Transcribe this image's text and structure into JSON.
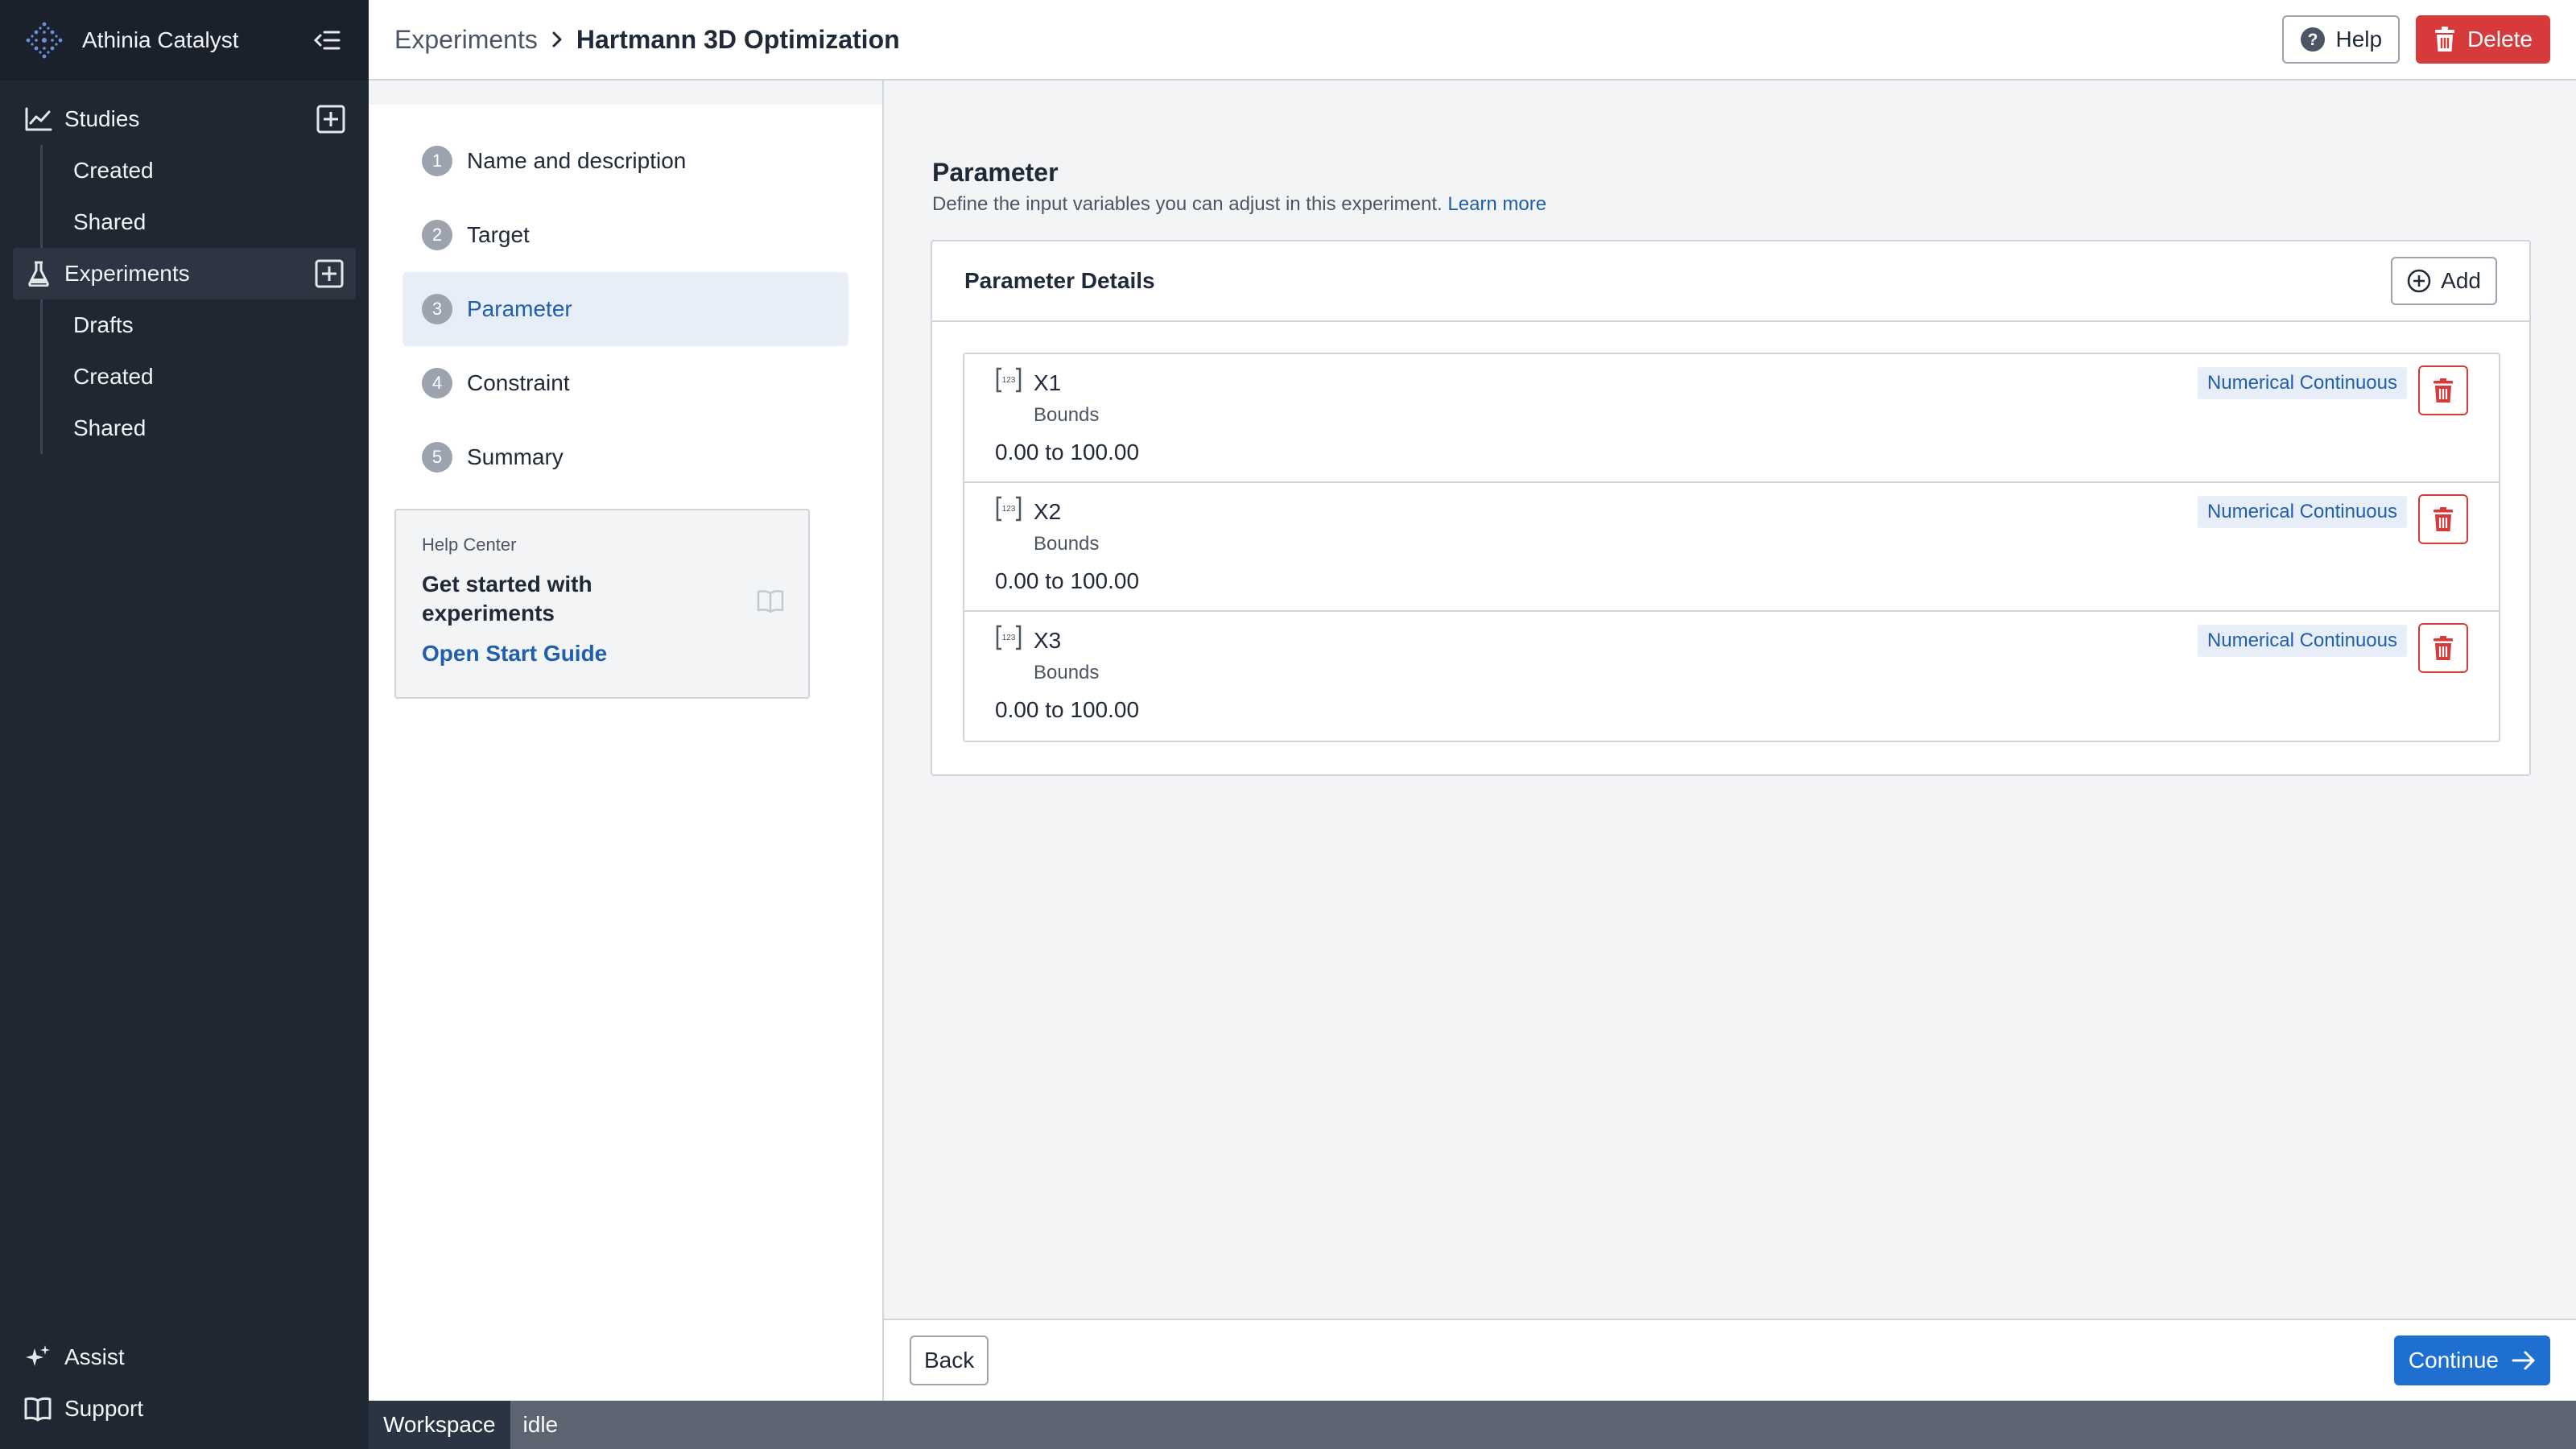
{
  "app": {
    "name": "Athinia Catalyst"
  },
  "sidebar": {
    "sections": [
      {
        "label": "Studies",
        "items": [
          "Created",
          "Shared"
        ]
      },
      {
        "label": "Experiments",
        "items": [
          "Drafts",
          "Created",
          "Shared"
        ]
      }
    ],
    "footer": [
      "Assist",
      "Support"
    ]
  },
  "header": {
    "breadcrumb_parent": "Experiments",
    "breadcrumb_current": "Hartmann 3D Optimization",
    "help_label": "Help",
    "delete_label": "Delete"
  },
  "steps": [
    {
      "num": "1",
      "label": "Name and description"
    },
    {
      "num": "2",
      "label": "Target"
    },
    {
      "num": "3",
      "label": "Parameter"
    },
    {
      "num": "4",
      "label": "Constraint"
    },
    {
      "num": "5",
      "label": "Summary"
    }
  ],
  "help_card": {
    "kicker": "Help Center",
    "title": "Get started with experiments",
    "link": "Open Start Guide"
  },
  "main": {
    "title": "Parameter",
    "description": "Define the input variables you can adjust in this experiment.",
    "learn_more": "Learn more",
    "card_title": "Parameter Details",
    "add_label": "Add",
    "parameters": [
      {
        "name": "X1",
        "sub": "Bounds",
        "range": "0.00 to 100.00",
        "type": "Numerical Continuous"
      },
      {
        "name": "X2",
        "sub": "Bounds",
        "range": "0.00 to 100.00",
        "type": "Numerical Continuous"
      },
      {
        "name": "X3",
        "sub": "Bounds",
        "range": "0.00 to 100.00",
        "type": "Numerical Continuous"
      }
    ]
  },
  "footer": {
    "back_label": "Back",
    "continue_label": "Continue"
  },
  "status": {
    "workspace": "Workspace",
    "state": "idle"
  },
  "colors": {
    "sidebar_bg": "#1f2733",
    "accent_blue": "#1f6fd1",
    "link_blue": "#1f5fae",
    "danger_red": "#d63a3a",
    "active_step_bg": "#e8eef8"
  }
}
